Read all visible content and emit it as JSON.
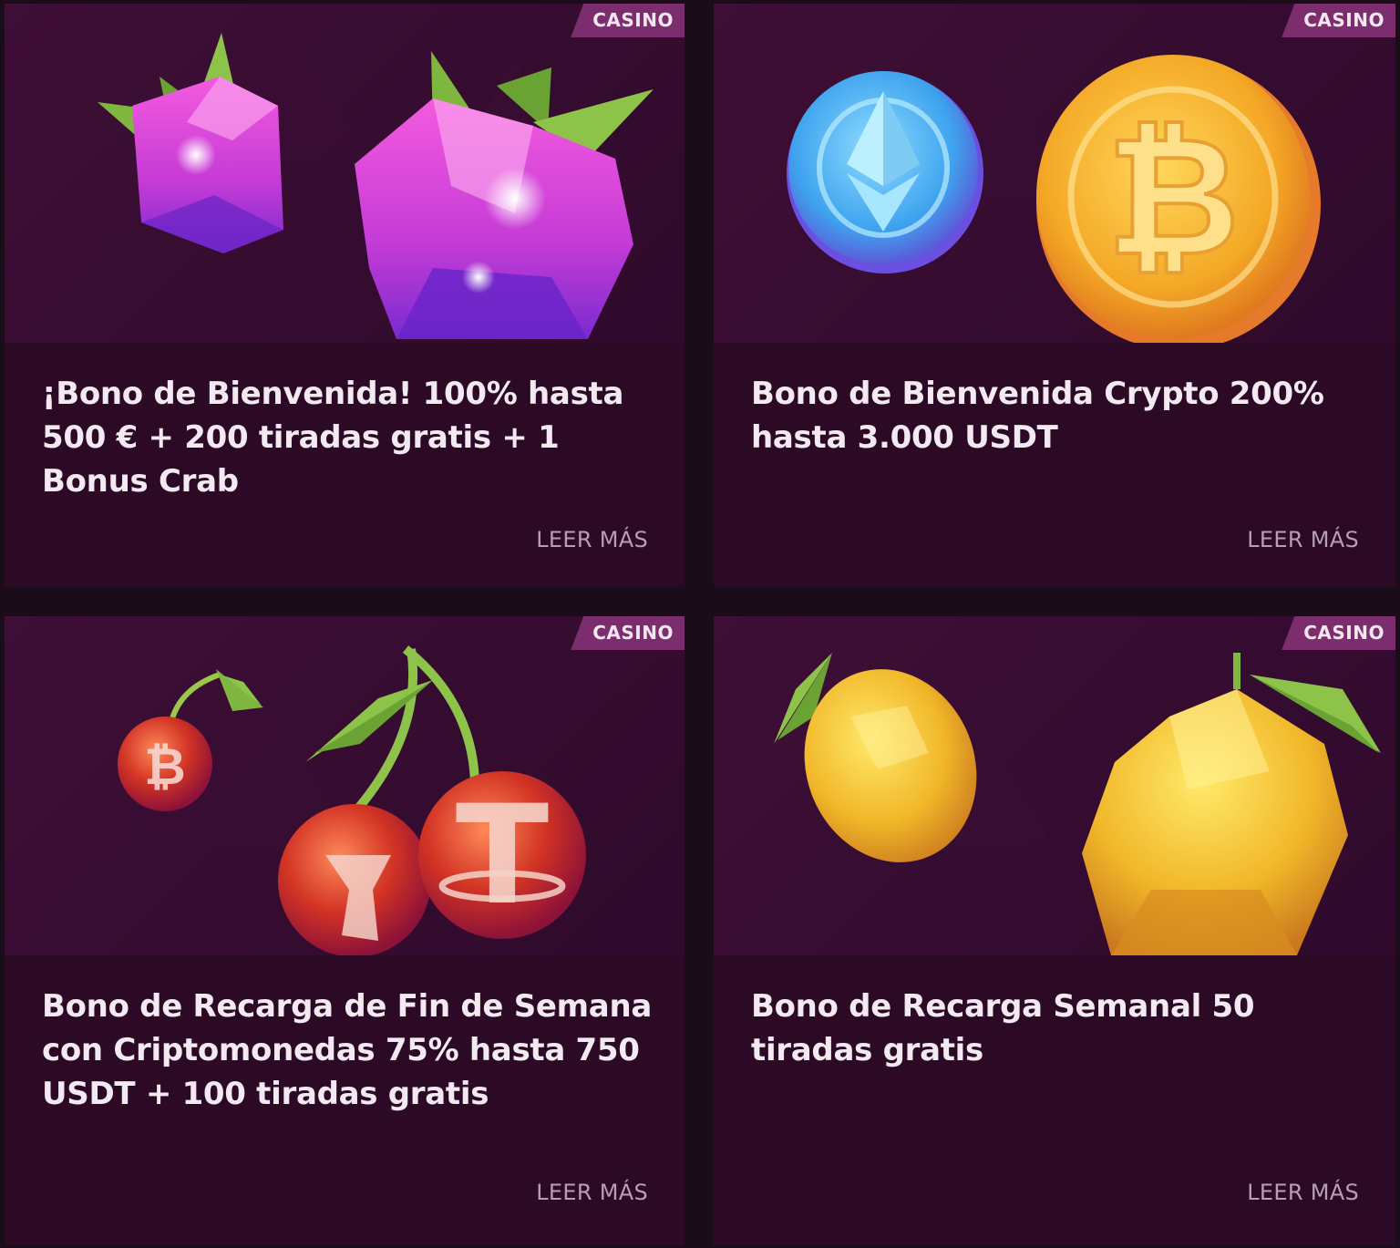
{
  "promotions": [
    {
      "tag": "CASINO",
      "title": "¡Bono de Bienvenida! 100% hasta 500 € + 200 tiradas gratis + 1 Bonus Crab",
      "cta": "LEER MÁS",
      "image": "raspberry-gems"
    },
    {
      "tag": "CASINO",
      "title": "Bono de Bienvenida Crypto 200% hasta 3.000 USDT",
      "cta": "LEER MÁS",
      "image": "ethereum-bitcoin-coins"
    },
    {
      "tag": "CASINO",
      "title": "Bono de Recarga de Fin de Semana con Criptomonedas 75% hasta 750 USDT + 100 tiradas gratis",
      "cta": "LEER MÁS",
      "image": "crypto-cherries"
    },
    {
      "tag": "CASINO",
      "title": "Bono de Recarga Semanal 50 tiradas gratis",
      "cta": "LEER MÁS",
      "image": "golden-lemons"
    }
  ]
}
